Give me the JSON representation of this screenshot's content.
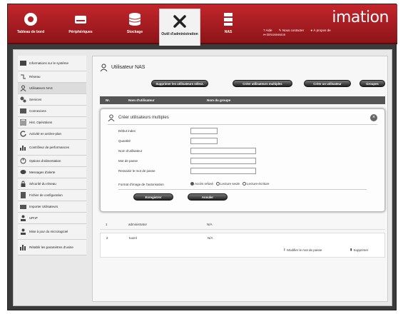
{
  "nav": {
    "items": [
      {
        "label": "Tableau de bord",
        "icon": "dashboard-icon"
      },
      {
        "label": "Périphériques",
        "icon": "device-icon"
      },
      {
        "label": "Stockage",
        "icon": "storage-icon"
      },
      {
        "label": "Outil d'administration",
        "icon": "admin-tools-icon"
      },
      {
        "label": "NAS",
        "icon": "nas-icon"
      }
    ],
    "brand": "imation",
    "links": [
      "Aide",
      "Nous contacter",
      "À propos de",
      "Déconnexion"
    ]
  },
  "sidebar": {
    "items": [
      {
        "label": "Informations sur le système",
        "icon": "info-icon"
      },
      {
        "label": "Réseau",
        "icon": "network-icon"
      },
      {
        "label": "Utilisateurs NAS",
        "icon": "user-icon"
      },
      {
        "label": "Services",
        "icon": "services-icon"
      },
      {
        "label": "Connexions",
        "icon": "connections-icon"
      },
      {
        "label": "Hist. Opérations",
        "icon": "history-icon"
      },
      {
        "label": "Activité en arrière-plan",
        "icon": "background-activity-icon"
      },
      {
        "label": "Contrôleur de performances",
        "icon": "performance-icon"
      },
      {
        "label": "Options d'alimentation",
        "icon": "power-icon"
      },
      {
        "label": "Messages d'alerte",
        "icon": "alert-icon"
      },
      {
        "label": "Sécurité du réseau",
        "icon": "lock-icon"
      },
      {
        "label": "Fichier de configuration",
        "icon": "config-file-icon"
      },
      {
        "label": "Importer Utilisateurs",
        "icon": "import-users-icon"
      },
      {
        "label": "UPnP",
        "icon": "upnp-icon"
      },
      {
        "label": "Mise à jour du micrologiciel",
        "icon": "firmware-icon"
      },
      {
        "label": "Rétablir les paramètres d'usine",
        "icon": "factory-reset-icon"
      }
    ]
  },
  "main": {
    "title": "Utilisateur NAS",
    "buttons": {
      "delete_all": "Supprimer les utilisateurs sélect.",
      "create_multi": "Créer utilisateurs multiples",
      "create_user": "Créer un utilisateur",
      "groups": "Groupes"
    },
    "columns": [
      "Nr.",
      "Nom d'utilisateur",
      "Nom du groupe"
    ],
    "rows": [
      {
        "nr": "1",
        "name": "administrator",
        "group": "N/A"
      },
      {
        "nr": "2",
        "name": "tuxml",
        "group": "N/A"
      }
    ],
    "row_actions": {
      "change_password": "Modifier le mot de passe",
      "delete": "Supprimer"
    }
  },
  "modal": {
    "title": "Créer utilisateurs multiples",
    "fields": [
      {
        "label": "Début index",
        "value": ""
      },
      {
        "label": "Quantité",
        "value": ""
      },
      {
        "label": "Nom d'utilisateur",
        "value": ""
      },
      {
        "label": "Mot de passe",
        "value": ""
      },
      {
        "label": "Ressaisir le mot de passe",
        "value": ""
      }
    ],
    "permission_label": "Format d'image de l'autorisation",
    "permission_options": [
      "Accès refusé",
      "Lecture seule",
      "Lecture-écriture"
    ],
    "permission_selected": "Accès refusé",
    "save": "Enregistrer",
    "cancel": "Annuler"
  }
}
